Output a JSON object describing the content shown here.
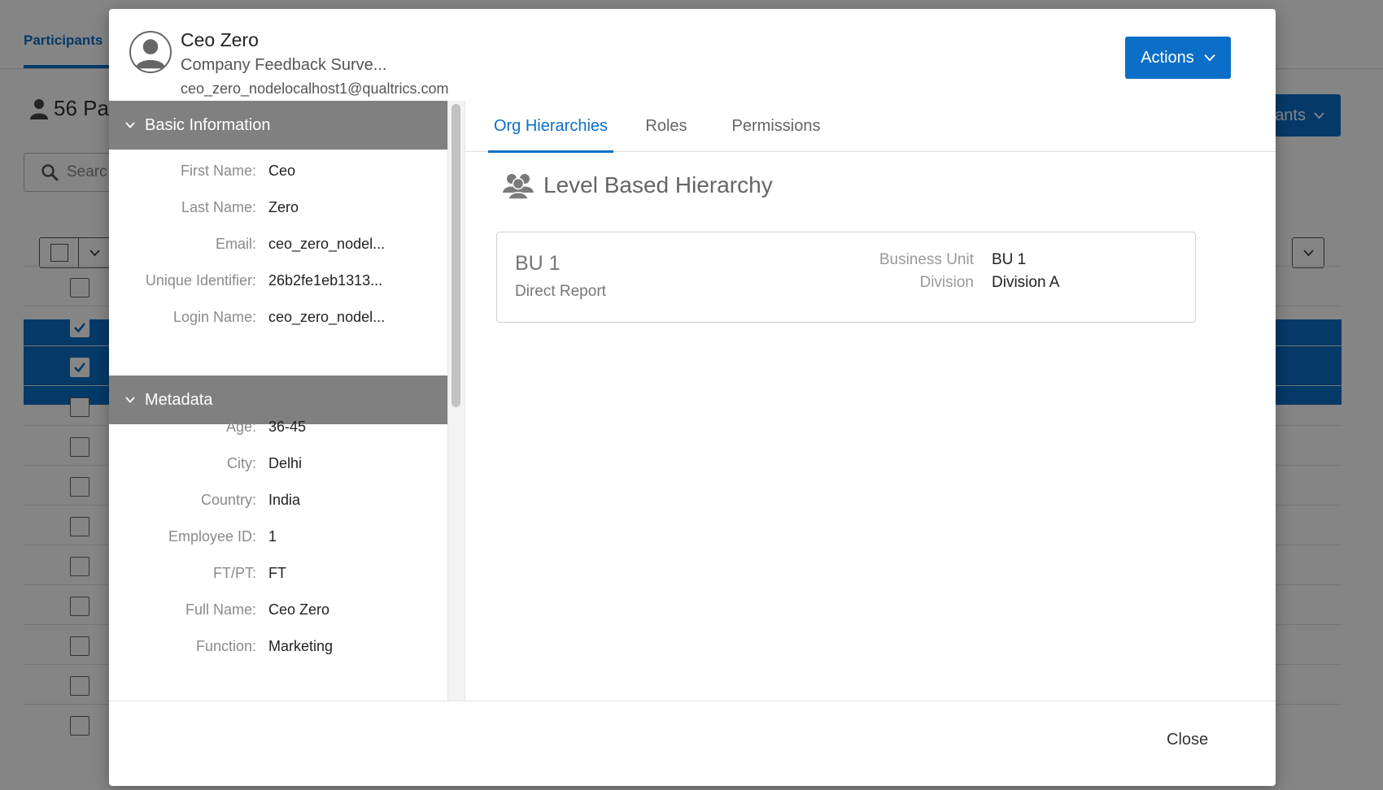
{
  "background": {
    "tab_label": "Participants",
    "count_text": "56 Pa",
    "search_placeholder": "Searc",
    "add_button_label": "ants",
    "rows": [
      {
        "checked": false
      },
      {
        "checked": true
      },
      {
        "checked": true
      },
      {
        "checked": false
      },
      {
        "checked": false
      },
      {
        "checked": false
      },
      {
        "checked": false
      },
      {
        "checked": false
      },
      {
        "checked": false
      },
      {
        "checked": false
      },
      {
        "checked": false
      },
      {
        "checked": false
      }
    ]
  },
  "modal": {
    "name": "Ceo Zero",
    "survey": "Company Feedback Surve...",
    "email": "ceo_zero_nodelocalhost1@qualtrics.com",
    "actions_label": "Actions",
    "close_label": "Close"
  },
  "basic_info": {
    "title": "Basic Information",
    "fields": [
      {
        "label": "First Name:",
        "value": "Ceo"
      },
      {
        "label": "Last Name:",
        "value": "Zero"
      },
      {
        "label": "Email:",
        "value": "ceo_zero_nodel..."
      },
      {
        "label": "Unique Identifier:",
        "value": "26b2fe1eb1313..."
      },
      {
        "label": "Login Name:",
        "value": "ceo_zero_nodel..."
      }
    ]
  },
  "metadata": {
    "title": "Metadata",
    "fields": [
      {
        "label": "Age:",
        "value": "36-45"
      },
      {
        "label": "City:",
        "value": "Delhi"
      },
      {
        "label": "Country:",
        "value": "India"
      },
      {
        "label": "Employee ID:",
        "value": "1"
      },
      {
        "label": "FT/PT:",
        "value": "FT"
      },
      {
        "label": "Full Name:",
        "value": "Ceo Zero"
      },
      {
        "label": "Function:",
        "value": "Marketing"
      }
    ]
  },
  "tabs": [
    {
      "label": "Org Hierarchies",
      "active": true
    },
    {
      "label": "Roles",
      "active": false
    },
    {
      "label": "Permissions",
      "active": false
    }
  ],
  "hierarchy": {
    "title": "Level Based Hierarchy",
    "unit": "BU 1",
    "relation": "Direct Report",
    "attributes": [
      {
        "key": "Business Unit",
        "value": "BU 1"
      },
      {
        "key": "Division",
        "value": "Division A"
      }
    ]
  },
  "colors": {
    "accent": "#0b6ec7",
    "section_header": "#808080"
  }
}
